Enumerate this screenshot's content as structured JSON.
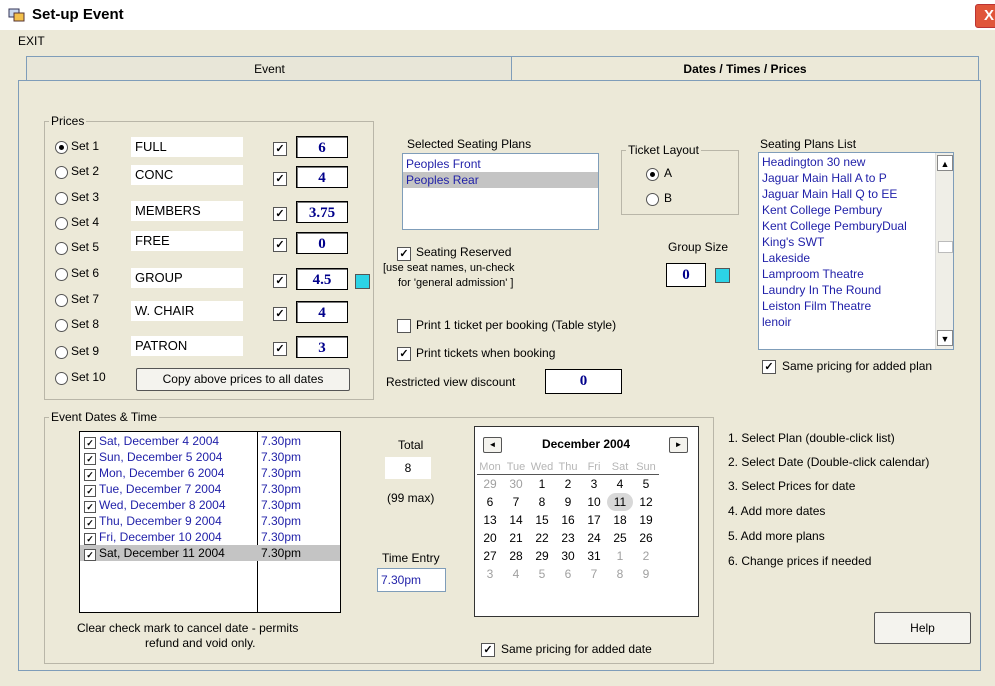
{
  "window": {
    "title": "Set-up Event",
    "close_glyph": "X"
  },
  "menu": {
    "exit": "EXIT"
  },
  "tabs": [
    {
      "label": "Event"
    },
    {
      "label": "Dates / Times / Prices"
    }
  ],
  "prices": {
    "legend": "Prices",
    "rows": [
      {
        "set": "Set 1",
        "name": "FULL",
        "value": "6",
        "checked": true,
        "selected": true
      },
      {
        "set": "Set 2",
        "name": "CONC",
        "value": "4",
        "checked": true
      },
      {
        "set": "Set 3",
        "name": "MEMBERS",
        "value": "3.75",
        "checked": true
      },
      {
        "set": "Set 4",
        "name": "FREE",
        "value": "0",
        "checked": true
      },
      {
        "set": "Set 5",
        "name": "GROUP",
        "value": "4.5",
        "checked": true
      },
      {
        "set": "Set 6",
        "name": "W. CHAIR",
        "value": "4",
        "checked": true
      },
      {
        "set": "Set 7",
        "name": "PATRON",
        "value": "3",
        "checked": true
      },
      {
        "set": "Set 8"
      },
      {
        "set": "Set 9"
      },
      {
        "set": "Set 10"
      }
    ],
    "copy_button": "Copy above prices to all dates"
  },
  "selected_plans": {
    "label": "Selected Seating Plans",
    "items": [
      "Peoples Front",
      "Peoples Rear"
    ]
  },
  "ticket_layout": {
    "legend": "Ticket Layout",
    "options": [
      "A",
      "B"
    ]
  },
  "seating_reserved": {
    "label": "Seating Reserved",
    "note1": "[use seat names, un-check",
    "note2": "for 'general admission' ]"
  },
  "group_size": {
    "label": "Group Size",
    "value": "0"
  },
  "print_one": "Print 1 ticket per booking (Table style)",
  "print_when": "Print tickets when booking",
  "restricted": {
    "label": "Restricted view discount",
    "value": "0"
  },
  "plans_list": {
    "label": "Seating Plans List",
    "items": [
      "Headington 30 new",
      "Jaguar Main Hall A to P",
      "Jaguar Main Hall Q to EE",
      "Kent College Pembury",
      "Kent College PemburyDual",
      "King's SWT",
      "Lakeside",
      "Lamproom Theatre",
      "Laundry In The Round",
      "Leiston Film Theatre",
      "lenoir"
    ],
    "same_pricing": "Same pricing for added plan"
  },
  "event_dates": {
    "legend": "Event Dates & Time",
    "dates": [
      {
        "date": "Sat, December 4 2004",
        "time": "7.30pm"
      },
      {
        "date": "Sun, December 5 2004",
        "time": "7.30pm"
      },
      {
        "date": "Mon, December 6 2004",
        "time": "7.30pm"
      },
      {
        "date": "Tue, December 7 2004",
        "time": "7.30pm"
      },
      {
        "date": "Wed, December 8 2004",
        "time": "7.30pm"
      },
      {
        "date": "Thu, December 9 2004",
        "time": "7.30pm"
      },
      {
        "date": "Fri, December 10 2004",
        "time": "7.30pm"
      },
      {
        "date": "Sat, December 11 2004",
        "time": "7.30pm"
      }
    ],
    "clear_note1": "Clear check mark to cancel date - permits",
    "clear_note2": "refund and void only.",
    "total_label": "Total",
    "total_value": "8",
    "max_note": "(99 max)",
    "time_entry_label": "Time Entry",
    "time_entry_value": "7.30pm"
  },
  "calendar": {
    "month": "December 2004",
    "prev": "◄",
    "next": "►",
    "weekdays": [
      "Mon",
      "Tue",
      "Wed",
      "Thu",
      "Fri",
      "Sat",
      "Sun"
    ],
    "weeks": [
      [
        "29",
        "30",
        "1",
        "2",
        "3",
        "4",
        "5"
      ],
      [
        "6",
        "7",
        "8",
        "9",
        "10",
        "11",
        "12"
      ],
      [
        "13",
        "14",
        "15",
        "16",
        "17",
        "18",
        "19"
      ],
      [
        "20",
        "21",
        "22",
        "23",
        "24",
        "25",
        "26"
      ],
      [
        "27",
        "28",
        "29",
        "30",
        "31",
        "1",
        "2"
      ],
      [
        "3",
        "4",
        "5",
        "6",
        "7",
        "8",
        "9"
      ]
    ],
    "same_pricing": "Same pricing for added date"
  },
  "instructions": [
    "1. Select Plan (double-click list)",
    "2. Select Date (Double-click calendar)",
    "3. Select Prices for date",
    "4. Add more dates",
    "5. Add more plans",
    "6. Change prices if needed"
  ],
  "help_button": "Help",
  "colors": {
    "value_blue": "#00008b",
    "list_blue": "#1f1fa8",
    "swatch_cyan": "#2cd3e6",
    "close_red": "#e0553a"
  }
}
